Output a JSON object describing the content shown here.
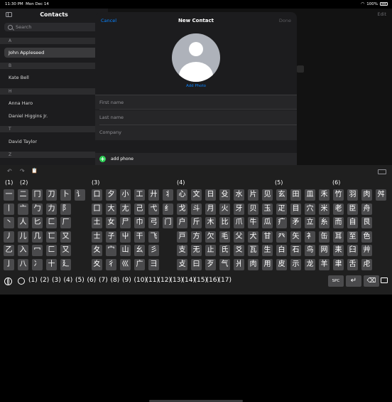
{
  "status": {
    "time": "11:30 PM",
    "date": "Mon Dec 14",
    "battery": "100%"
  },
  "sidebar": {
    "title": "Contacts",
    "search_placeholder": "Search",
    "sections": [
      {
        "letter": "A",
        "contacts": [
          "John Appleseed"
        ]
      },
      {
        "letter": "B",
        "contacts": [
          "Kate Bell"
        ]
      },
      {
        "letter": "H",
        "contacts": [
          "Anna Haro",
          "Daniel Higgins Jr."
        ]
      },
      {
        "letter": "T",
        "contacts": [
          "David Taylor"
        ]
      },
      {
        "letter": "Z",
        "contacts": []
      }
    ],
    "selected_contact": "John Appleseed",
    "index_letters": [
      "A",
      "B",
      "C",
      "D",
      "E",
      "F",
      "G",
      "H",
      "I",
      "J",
      "K",
      "L",
      "M",
      "N",
      "O",
      "P",
      "Q",
      "R",
      "S",
      "T",
      "U",
      "V",
      "W",
      "X",
      "Y",
      "Z",
      "#"
    ]
  },
  "detail": {
    "edit_label": "Edit"
  },
  "modal": {
    "cancel": "Cancel",
    "title": "New Contact",
    "done": "Done",
    "add_photo": "Add Photo",
    "fields": [
      "First name",
      "Last name",
      "Company"
    ],
    "add_phone": "add phone"
  },
  "keyboard": {
    "toolbar": {
      "undo": "↶",
      "redo": "↷",
      "paste": "📋"
    },
    "group_headers": [
      "(1)",
      "(2)",
      "(3)",
      "(4)",
      "(5)",
      "(6)"
    ],
    "rows": [
      [
        "一",
        "二",
        "冂",
        "刀",
        "卜",
        "讠",
        "口",
        "夕",
        "小",
        "工",
        "廾",
        "丬",
        "心",
        "文",
        "日",
        "殳",
        "水",
        "片",
        "见",
        "玄",
        "田",
        "皿",
        "禾",
        "竹",
        "羽",
        "肉",
        "舛"
      ],
      [
        "丨",
        "亠",
        "勹",
        "力",
        "阝",
        "",
        "囗",
        "大",
        "尢",
        "己",
        "弋",
        "纟",
        "戈",
        "斗",
        "月",
        "火",
        "牙",
        "贝",
        "玉",
        "疋",
        "目",
        "穴",
        "米",
        "老",
        "臣",
        "舟"
      ],
      [
        "丶",
        "人",
        "匕",
        "匚",
        "厂",
        "",
        "土",
        "女",
        "尸",
        "巾",
        "弓",
        "门",
        "户",
        "斤",
        "木",
        "比",
        "爪",
        "牛",
        "瓜",
        "疒",
        "矛",
        "立",
        "糸",
        "而",
        "自",
        "艮"
      ],
      [
        "丿",
        "儿",
        "几",
        "匸",
        "又",
        "",
        "士",
        "子",
        "屮",
        "干",
        "飞",
        "",
        "戸",
        "方",
        "欠",
        "毛",
        "父",
        "犬",
        "甘",
        "癶",
        "矢",
        "衤",
        "缶",
        "耳",
        "至",
        "色"
      ],
      [
        "乙",
        "入",
        "冖",
        "匚",
        "又",
        "",
        "夂",
        "宀",
        "山",
        "幺",
        "彡",
        "",
        "支",
        "无",
        "止",
        "氏",
        "爻",
        "瓦",
        "生",
        "白",
        "石",
        "鸟",
        "网",
        "耒",
        "臼",
        "艸"
      ],
      [
        "亅",
        "八",
        "冫",
        "十",
        "廴",
        "",
        "夊",
        "彳",
        "巛",
        "广",
        "彐",
        "",
        "攴",
        "曰",
        "歹",
        "气",
        "爿",
        "肉",
        "用",
        "皮",
        "示",
        "龙",
        "羊",
        "聿",
        "舌",
        "虍"
      ]
    ],
    "numbers": [
      "(1)",
      "(2)",
      "(3)",
      "(4)",
      "(5)",
      "(6)",
      "(7)",
      "(8)",
      "(9)",
      "(10)",
      "(11)",
      "(12)",
      "(13)",
      "(14)",
      "(15)",
      "(16)",
      "(17)"
    ],
    "space_label": "SPC",
    "enter_symbol": "↵",
    "delete_symbol": "⌫"
  }
}
